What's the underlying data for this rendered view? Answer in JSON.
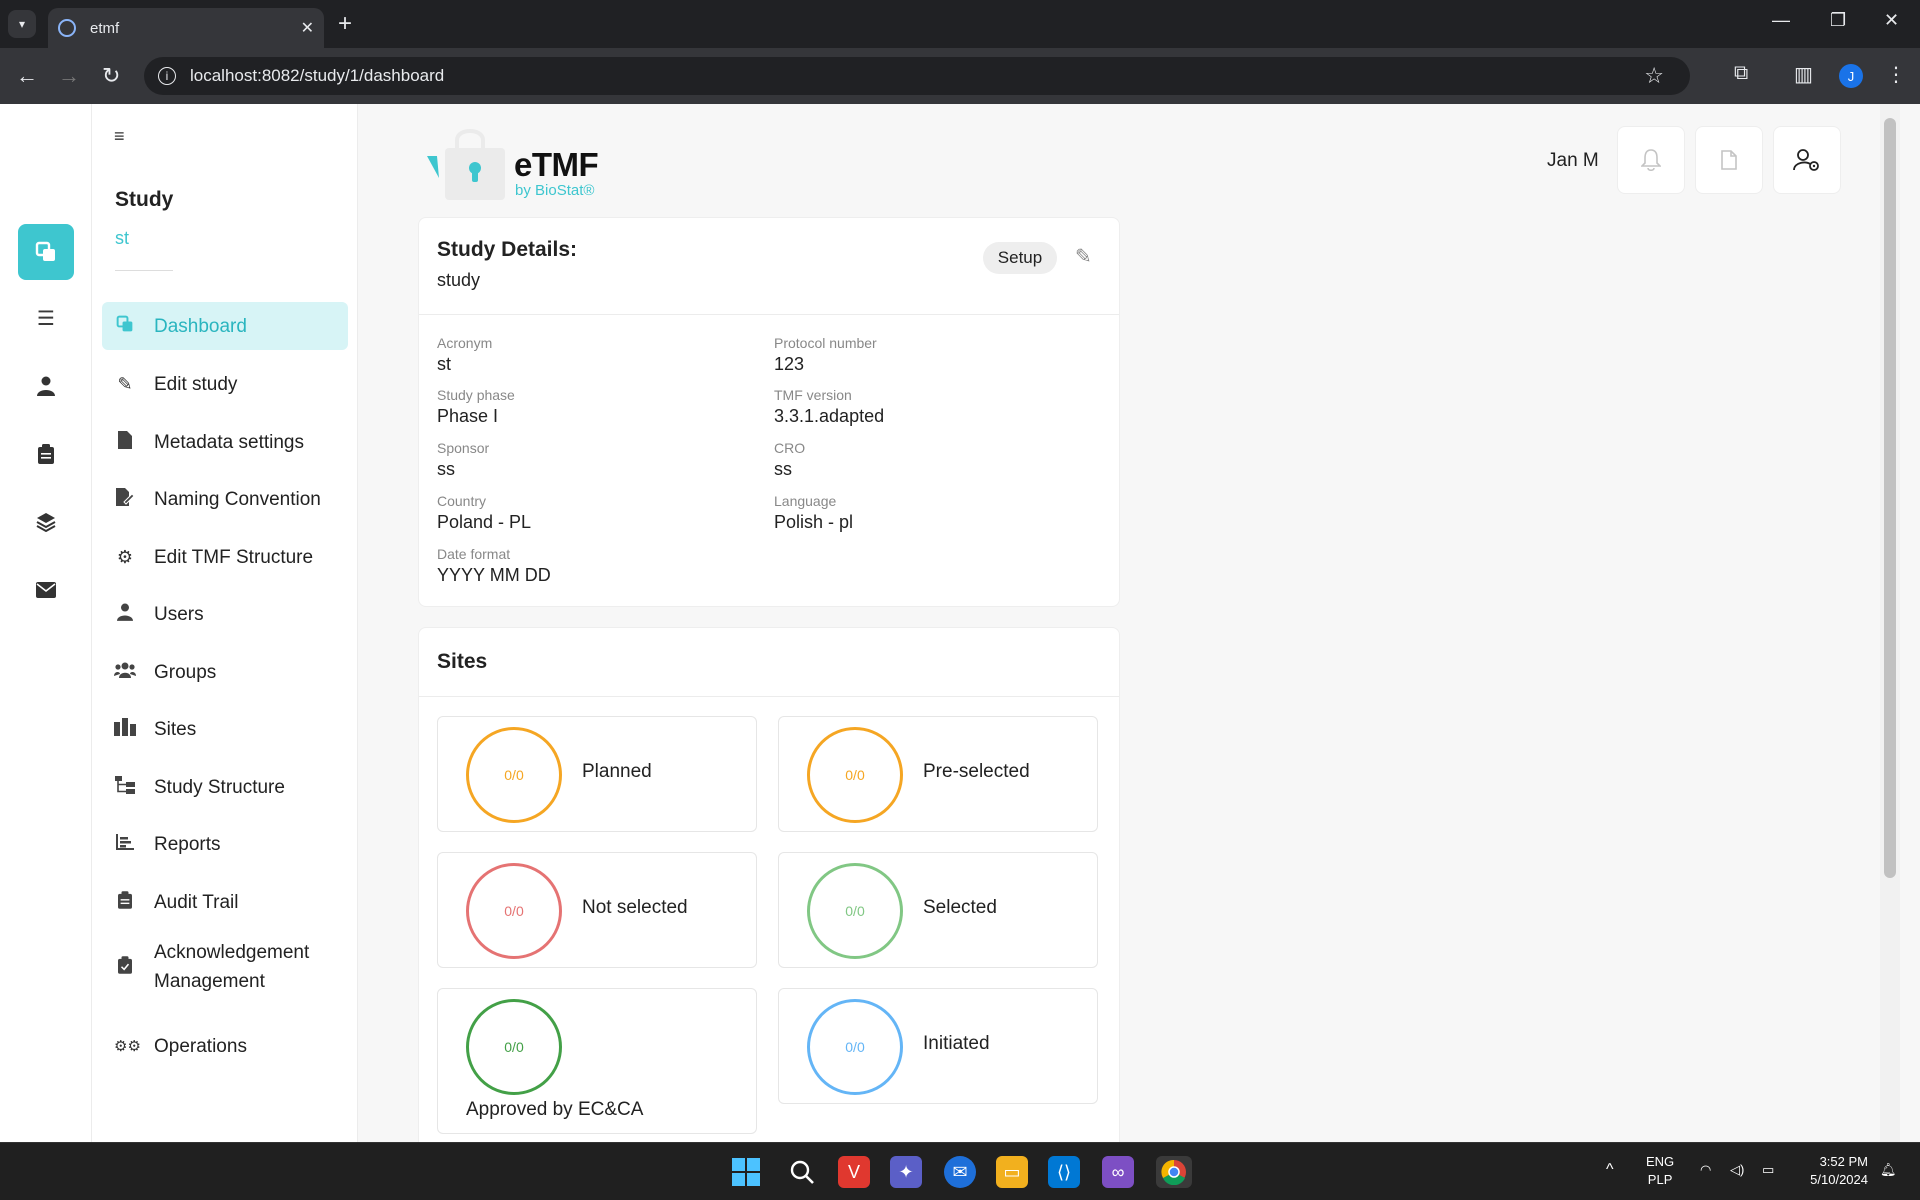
{
  "browser": {
    "tab_title": "etmf",
    "url": "localhost:8082/study/1/dashboard",
    "profile_initial": "J"
  },
  "rail": {
    "icons": [
      "dashboard-icon",
      "list-icon",
      "user-icon",
      "clipboard-icon",
      "layers-icon",
      "mail-icon"
    ]
  },
  "sidebar": {
    "study_label": "Study",
    "study_acronym": "st",
    "items": [
      {
        "label": "Dashboard",
        "icon": "dashboard-icon",
        "active": true
      },
      {
        "label": "Edit study",
        "icon": "pencil-icon"
      },
      {
        "label": "Metadata settings",
        "icon": "document-icon"
      },
      {
        "label": "Naming Convention",
        "icon": "document-edit-icon"
      },
      {
        "label": "Edit TMF Structure",
        "icon": "gear-icon"
      },
      {
        "label": "Users",
        "icon": "user-icon"
      },
      {
        "label": "Groups",
        "icon": "group-icon"
      },
      {
        "label": "Sites",
        "icon": "building-icon"
      },
      {
        "label": "Study Structure",
        "icon": "tree-icon"
      },
      {
        "label": "Reports",
        "icon": "chart-icon"
      },
      {
        "label": "Audit Trail",
        "icon": "clipboard-icon"
      },
      {
        "label": "Acknowledgement Management",
        "icon": "clipboard-check-icon"
      },
      {
        "label": "Operations",
        "icon": "gears-icon"
      }
    ]
  },
  "header": {
    "logo_text": "eTMF",
    "logo_sub": "by BioStat®",
    "user_name": "Jan M"
  },
  "study_details": {
    "title": "Study Details:",
    "name": "study",
    "setup_label": "Setup",
    "fields": {
      "acronym": {
        "label": "Acronym",
        "value": "st"
      },
      "protocol": {
        "label": "Protocol number",
        "value": "123"
      },
      "phase": {
        "label": "Study phase",
        "value": "Phase I"
      },
      "tmf": {
        "label": "TMF version",
        "value": "3.3.1.adapted"
      },
      "sponsor": {
        "label": "Sponsor",
        "value": "ss"
      },
      "cro": {
        "label": "CRO",
        "value": "ss"
      },
      "country": {
        "label": "Country",
        "value": "Poland - PL"
      },
      "language": {
        "label": "Language",
        "value": "Polish - pl"
      },
      "date_format": {
        "label": "Date format",
        "value": "YYYY MM DD"
      }
    }
  },
  "sites": {
    "title": "Sites",
    "statuses": [
      {
        "label": "Planned",
        "count": "0/0",
        "color": "#f5a623"
      },
      {
        "label": "Pre-selected",
        "count": "0/0",
        "color": "#f5a623"
      },
      {
        "label": "Not selected",
        "count": "0/0",
        "color": "#e57373"
      },
      {
        "label": "Selected",
        "count": "0/0",
        "color": "#81c784"
      },
      {
        "label": "Approved by EC&CA",
        "count": "0/0",
        "color": "#43a047"
      },
      {
        "label": "Initiated",
        "count": "0/0",
        "color": "#64b5f6"
      }
    ]
  },
  "taskbar": {
    "lang_top": "ENG",
    "lang_bottom": "PLP",
    "time": "3:52 PM",
    "date": "5/10/2024"
  },
  "colors": {
    "accent": "#3ec6cf",
    "accent_light": "#d7f4f6"
  }
}
